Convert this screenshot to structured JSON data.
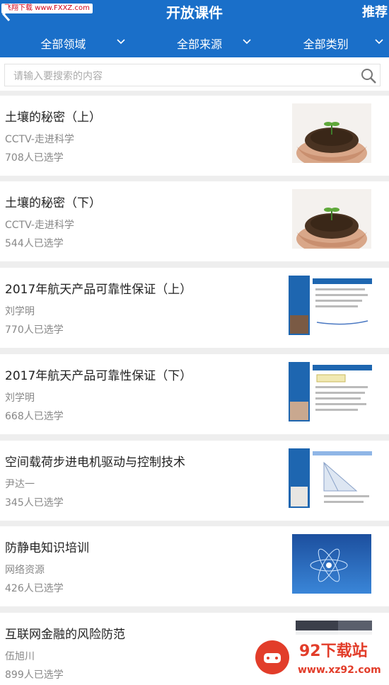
{
  "header": {
    "title": "开放课件",
    "recommend": "推荐",
    "watermark": "飞翔下载 www.FXXZ.com"
  },
  "filters": [
    {
      "label": "全部领域"
    },
    {
      "label": "全部来源"
    },
    {
      "label": "全部类别"
    }
  ],
  "search": {
    "placeholder": "请输入要搜索的内容"
  },
  "items": [
    {
      "title": "土壤的秘密（上）",
      "source": "CCTV-走进科学",
      "count": "708人已选学"
    },
    {
      "title": "土壤的秘密（下）",
      "source": "CCTV-走进科学",
      "count": "544人已选学"
    },
    {
      "title": "2017年航天产品可靠性保证（上）",
      "source": "刘学明",
      "count": "770人已选学"
    },
    {
      "title": "2017年航天产品可靠性保证（下）",
      "source": "刘学明",
      "count": "668人已选学"
    },
    {
      "title": "空间载荷步进电机驱动与控制技术",
      "source": "尹达一",
      "count": "345人已选学"
    },
    {
      "title": "防静电知识培训",
      "source": "网络资源",
      "count": "426人已选学"
    },
    {
      "title": "互联网金融的风险防范",
      "source": "伍旭川",
      "count": "899人已选学"
    }
  ],
  "bottom_watermark": {
    "brand": "92下载站",
    "url": "www.xz92.com"
  }
}
